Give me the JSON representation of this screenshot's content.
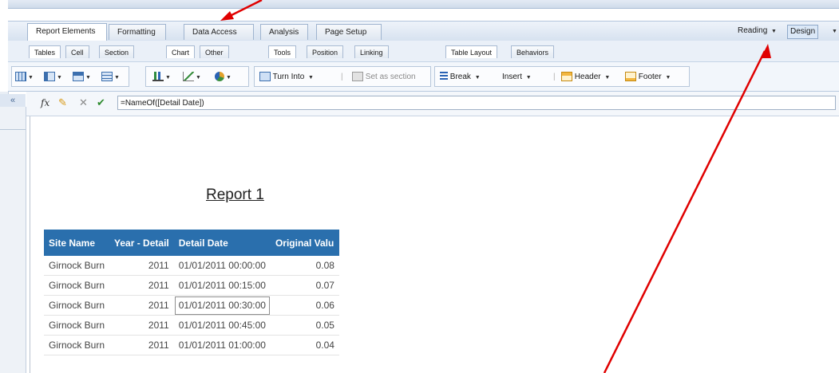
{
  "ribbon": {
    "main_tabs": [
      {
        "label": "Report Elements",
        "active": true
      },
      {
        "label": "Formatting",
        "active": false
      },
      {
        "label": "Data Access",
        "active": false
      },
      {
        "label": "Analysis",
        "active": false
      },
      {
        "label": "Page Setup",
        "active": false
      }
    ],
    "modes": {
      "reading": "Reading",
      "design": "Design"
    },
    "sub_tabs": [
      {
        "label": "Tables",
        "active": true
      },
      {
        "label": "Cell",
        "active": false
      },
      {
        "label": "Section",
        "active": false
      },
      {
        "label": "Chart",
        "active": true
      },
      {
        "label": "Other",
        "active": false
      },
      {
        "label": "Tools",
        "active": true
      },
      {
        "label": "Position",
        "active": false
      },
      {
        "label": "Linking",
        "active": false
      },
      {
        "label": "Table Layout",
        "active": true
      },
      {
        "label": "Behaviors",
        "active": false
      }
    ],
    "tools": {
      "turn_into": "Turn Into",
      "set_as_section": "Set as section",
      "break": "Break",
      "insert": "Insert",
      "header": "Header",
      "footer": "Footer"
    }
  },
  "formula_bar": {
    "value": "=NameOf([Detail Date])"
  },
  "report": {
    "title": "Report 1",
    "columns": [
      "Site Name",
      "Year - Detail",
      "Detail Date",
      "Original Valu"
    ],
    "rows": [
      [
        "Girnock Burn",
        "2011",
        "01/01/2011 00:00:00",
        "0.08"
      ],
      [
        "Girnock Burn",
        "2011",
        "01/01/2011 00:15:00",
        "0.07"
      ],
      [
        "Girnock Burn",
        "2011",
        "01/01/2011 00:30:00",
        "0.06"
      ],
      [
        "Girnock Burn",
        "2011",
        "01/01/2011 00:45:00",
        "0.05"
      ],
      [
        "Girnock Burn",
        "2011",
        "01/01/2011 01:00:00",
        "0.04"
      ]
    ],
    "selected_row": 2
  },
  "annotation_color": "#e00000",
  "accent_color": "#2a6fad"
}
